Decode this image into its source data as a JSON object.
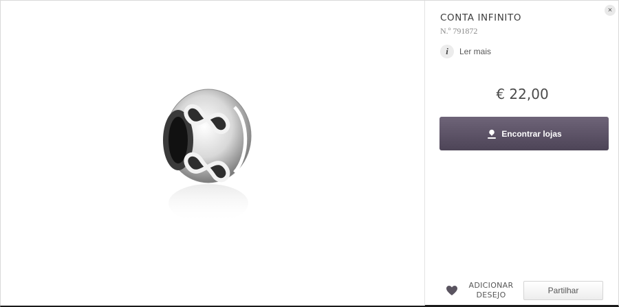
{
  "product": {
    "title": "CONTA INFINITO",
    "sku": "N.º 791872",
    "image_alt": "silver-infinity-charm-bead"
  },
  "actions": {
    "read_more_label": "Ler mais",
    "find_stores_label": "Encontrar lojas",
    "wishlist_label": "ADICIONAR DESEJO",
    "share_label": "Partilhar",
    "close_label": "×"
  },
  "pricing": {
    "price": "€ 22,00"
  },
  "icons": {
    "close": "close-icon",
    "info": "info-icon",
    "pin": "map-pin-icon",
    "heart": "heart-icon"
  },
  "colors": {
    "primary_button": "#5c5266",
    "text": "#4a4a4a",
    "heart": "#5a5460"
  }
}
